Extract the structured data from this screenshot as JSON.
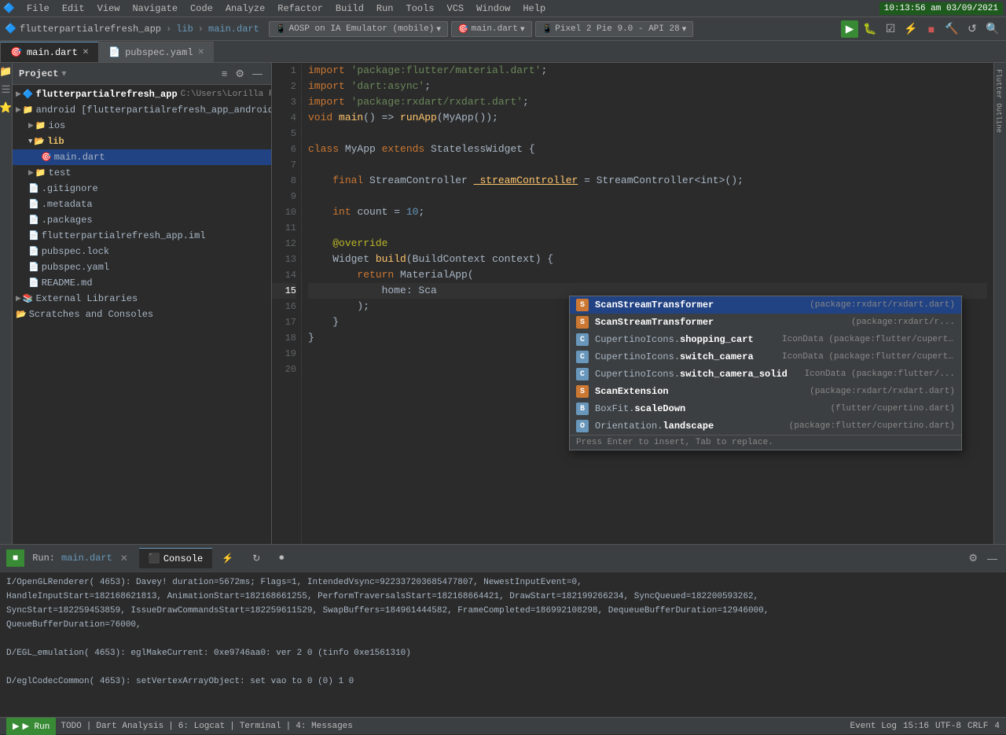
{
  "menubar": {
    "logo": "🔷",
    "items": [
      "File",
      "Edit",
      "View",
      "Navigate",
      "Code",
      "Analyze",
      "Refactor",
      "Build",
      "Run",
      "Tools",
      "VCS",
      "Window",
      "Help"
    ],
    "clock": "10:13:56 am 03/09/2021"
  },
  "toolbar": {
    "brand": "flutterpartialrefresh_app",
    "breadcrumbs": [
      "lib",
      "main.dart"
    ],
    "emulator": "AOSP on IA Emulator (mobile)",
    "run_config": "main.dart",
    "device": "Pixel 2 Pie 9.0 - API 28"
  },
  "tabs": [
    {
      "label": "main.dart",
      "active": true
    },
    {
      "label": "pubspec.yaml",
      "active": false
    }
  ],
  "project": {
    "title": "Project",
    "tree": [
      {
        "level": 0,
        "icon": "▶",
        "name": "flutterpartialrefresh_app",
        "type": "root",
        "extra": "C:\\Users\\Lorilla Family\\"
      },
      {
        "level": 1,
        "icon": "▶",
        "name": "android [flutterpartialrefresh_app_android]",
        "type": "folder"
      },
      {
        "level": 1,
        "icon": "▶",
        "name": "ios",
        "type": "folder"
      },
      {
        "level": 1,
        "icon": "▼",
        "name": "lib",
        "type": "folder",
        "expanded": true
      },
      {
        "level": 2,
        "icon": "📄",
        "name": "main.dart",
        "type": "file",
        "selected": true
      },
      {
        "level": 1,
        "icon": "▶",
        "name": "test",
        "type": "folder"
      },
      {
        "level": 1,
        "icon": "📄",
        "name": ".gitignore",
        "type": "file"
      },
      {
        "level": 1,
        "icon": "📄",
        "name": ".metadata",
        "type": "file"
      },
      {
        "level": 1,
        "icon": "📄",
        "name": ".packages",
        "type": "file"
      },
      {
        "level": 1,
        "icon": "📄",
        "name": "flutterpartialrefresh_app.iml",
        "type": "file"
      },
      {
        "level": 1,
        "icon": "📄",
        "name": "pubspec.lock",
        "type": "file"
      },
      {
        "level": 1,
        "icon": "📄",
        "name": "pubspec.yaml",
        "type": "file"
      },
      {
        "level": 1,
        "icon": "📄",
        "name": "README.md",
        "type": "file"
      },
      {
        "level": 0,
        "icon": "▶",
        "name": "External Libraries",
        "type": "folder"
      },
      {
        "level": 0,
        "icon": "📂",
        "name": "Scratches and Consoles",
        "type": "folder"
      }
    ]
  },
  "editor": {
    "filename": "main.dart",
    "lines": [
      {
        "num": 1,
        "tokens": [
          {
            "t": "import ",
            "c": "kw"
          },
          {
            "t": "'package:flutter/material.dart'",
            "c": "st"
          },
          {
            "t": ";",
            "c": ""
          }
        ]
      },
      {
        "num": 2,
        "tokens": [
          {
            "t": "import ",
            "c": "kw"
          },
          {
            "t": "'dart:async'",
            "c": "st"
          },
          {
            "t": ";",
            "c": ""
          }
        ]
      },
      {
        "num": 3,
        "tokens": [
          {
            "t": "import ",
            "c": "kw"
          },
          {
            "t": "'package:rxdart/rxdart.dart'",
            "c": "st"
          },
          {
            "t": ";",
            "c": ""
          }
        ]
      },
      {
        "num": 4,
        "tokens": [
          {
            "t": "void ",
            "c": "kw"
          },
          {
            "t": "main",
            "c": "fn"
          },
          {
            "t": "() => ",
            "c": ""
          },
          {
            "t": "runApp",
            "c": "fn"
          },
          {
            "t": "(",
            "c": ""
          },
          {
            "t": "MyApp",
            "c": "cl"
          },
          {
            "t": "());",
            "c": ""
          }
        ]
      },
      {
        "num": 5,
        "tokens": []
      },
      {
        "num": 6,
        "tokens": [
          {
            "t": "class ",
            "c": "kw"
          },
          {
            "t": "MyApp ",
            "c": "cl"
          },
          {
            "t": "extends ",
            "c": "kw"
          },
          {
            "t": "StatelessWidget",
            "c": "cl"
          },
          {
            "t": " {",
            "c": ""
          }
        ]
      },
      {
        "num": 7,
        "tokens": []
      },
      {
        "num": 8,
        "tokens": [
          {
            "t": "    final ",
            "c": "kw"
          },
          {
            "t": "StreamController",
            "c": "cl"
          },
          {
            "t": " ",
            "c": ""
          },
          {
            "t": "_streamController",
            "c": "hl"
          },
          {
            "t": " = ",
            "c": ""
          },
          {
            "t": "StreamController",
            "c": "cl"
          },
          {
            "t": "<int>();",
            "c": ""
          }
        ]
      },
      {
        "num": 9,
        "tokens": []
      },
      {
        "num": 10,
        "tokens": [
          {
            "t": "    int ",
            "c": "kw"
          },
          {
            "t": "count = ",
            "c": ""
          },
          {
            "t": "10",
            "c": "num"
          },
          {
            "t": ";",
            "c": ""
          }
        ]
      },
      {
        "num": 11,
        "tokens": []
      },
      {
        "num": 12,
        "tokens": [
          {
            "t": "    ",
            "c": ""
          },
          {
            "t": "@override",
            "c": "an"
          }
        ]
      },
      {
        "num": 13,
        "tokens": [
          {
            "t": "    ",
            "c": "kw"
          },
          {
            "t": "Widget ",
            "c": "cl"
          },
          {
            "t": "build",
            "c": "fn"
          },
          {
            "t": "(",
            "c": ""
          },
          {
            "t": "BuildContext",
            "c": "cl"
          },
          {
            "t": " context) {",
            "c": ""
          }
        ]
      },
      {
        "num": 14,
        "tokens": [
          {
            "t": "        return ",
            "c": "kw"
          },
          {
            "t": "MaterialApp",
            "c": "cl"
          },
          {
            "t": "(",
            "c": ""
          }
        ]
      },
      {
        "num": 15,
        "tokens": [
          {
            "t": "            home: Sca",
            "c": ""
          }
        ]
      },
      {
        "num": 16,
        "tokens": [
          {
            "t": "        );",
            "c": ""
          }
        ]
      },
      {
        "num": 17,
        "tokens": [
          {
            "t": "    }",
            "c": ""
          }
        ]
      },
      {
        "num": 18,
        "tokens": [
          {
            "t": "}",
            "c": ""
          }
        ]
      },
      {
        "num": 19,
        "tokens": []
      },
      {
        "num": 20,
        "tokens": []
      }
    ]
  },
  "autocomplete": {
    "items": [
      {
        "icon": "S",
        "icon_type": "orange",
        "name": "ScanStreamTransformer",
        "type": "(package:rxdart/rxdart.dart)",
        "selected": true
      },
      {
        "icon": "S",
        "icon_type": "orange",
        "name": "ScanStreamTransformer",
        "type": "(package:rxdart/r...",
        "selected": false
      },
      {
        "icon": "C",
        "icon_type": "blue",
        "name": "CupertinoIcons.shopping_cart",
        "type": "IconData (package:flutter/cupert...",
        "selected": false
      },
      {
        "icon": "C",
        "icon_type": "blue",
        "name": "CupertinoIcons.switch_camera",
        "type": "IconData (package:flutter/cupert...",
        "selected": false
      },
      {
        "icon": "C",
        "icon_type": "blue",
        "name": "CupertinoIcons.switch_camera_solid",
        "type": "IconData (package:flutter/...",
        "selected": false
      },
      {
        "icon": "S",
        "icon_type": "orange",
        "name": "ScanExtension",
        "type": "(package:rxdart/rxdart.dart)",
        "selected": false
      },
      {
        "icon": "B",
        "icon_type": "blue",
        "name": "BoxFit.scaleDown",
        "type": "(flutter/cupertino.dart)",
        "selected": false
      },
      {
        "icon": "O",
        "icon_type": "blue",
        "name": "Orientation.landscape",
        "type": "(package:flutter/cupertino.dart)",
        "selected": false
      }
    ],
    "hint": "Press Enter to insert, Tab to replace."
  },
  "bottom": {
    "run_label": "Run:",
    "run_file": "main.dart",
    "tabs": [
      "Console",
      "⚡",
      "↻",
      "⏺"
    ],
    "console_lines": [
      "I/OpenGLRenderer( 4653): Davey! duration=5672ms; Flags=1, IntendedVsync=922337203685477807, NewestInputEvent=0,",
      "HandleInputStart=182168621813, AnimationStart=182168661255, PerformTraversalsStart=182168664421, DrawStart=182199266234, SyncQueued=182200593262,",
      "SyncStart=182259453859, IssueDrawCommandsStart=182259611529, SwapBuffers=184961444582, FrameCompleted=186992108298, DequeueBufferDuration=12946000,",
      "QueueBufferDuration=76000,",
      "",
      "D/EGL_emulation( 4653): eglMakeCurrent: 0xe9746aa0: ver 2 0 (tinfo 0xe1561310)",
      "",
      "D/eglCodecCommon( 4653): setVertexArrayObject: set vao to 0 (0) 1 0"
    ]
  },
  "statusbar": {
    "run_label": "▶ Run",
    "todo": "TODO",
    "dart_analysis": "Dart Analysis",
    "logcat_num": "6",
    "logcat": "Logcat",
    "terminal": "Terminal",
    "messages_num": "4",
    "messages": "Messages",
    "event_log": "Event Log",
    "position": "15:16",
    "encoding": "UTF-8",
    "line_sep": "CRLF",
    "indent": "4"
  }
}
